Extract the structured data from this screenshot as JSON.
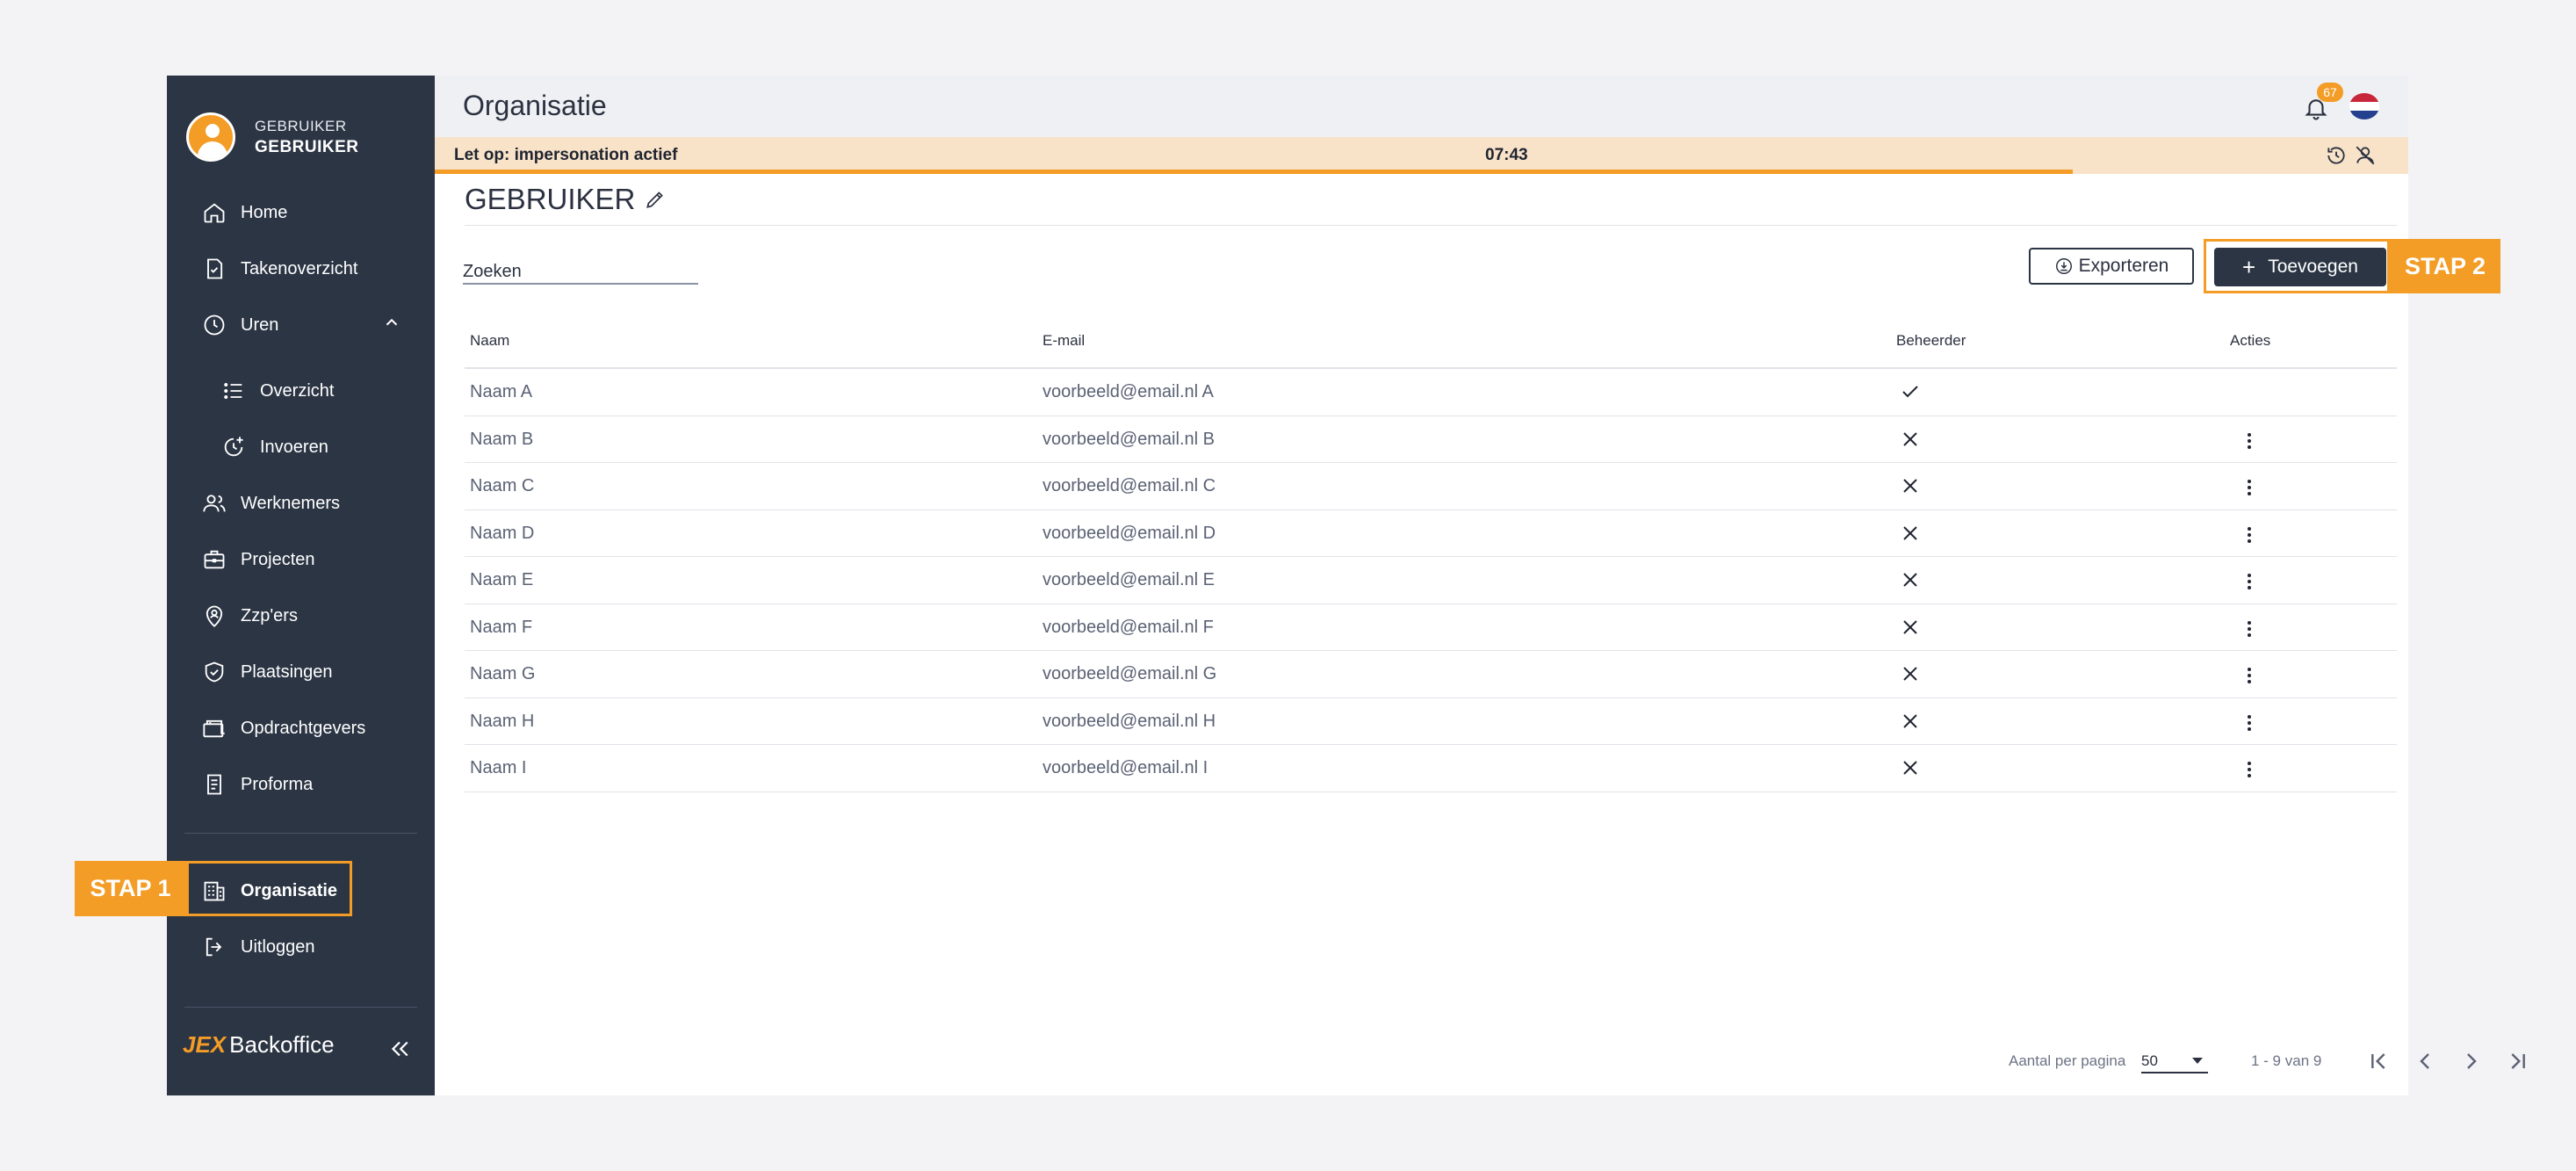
{
  "user": {
    "line1": "GEBRUIKER",
    "line2": "GEBRUIKER"
  },
  "sidebar": {
    "items": [
      {
        "label": "Home",
        "icon": "home-icon"
      },
      {
        "label": "Takenoverzicht",
        "icon": "task-icon"
      },
      {
        "label": "Uren",
        "icon": "clock-icon",
        "expanded": true
      },
      {
        "label": "Overzicht",
        "icon": "list-icon"
      },
      {
        "label": "Invoeren",
        "icon": "clock-add-icon"
      },
      {
        "label": "Werknemers",
        "icon": "users-icon"
      },
      {
        "label": "Projecten",
        "icon": "briefcase-icon"
      },
      {
        "label": "Zzp'ers",
        "icon": "location-user-icon"
      },
      {
        "label": "Plaatsingen",
        "icon": "shield-check-icon"
      },
      {
        "label": "Opdrachtgevers",
        "icon": "folder-briefcase-icon"
      },
      {
        "label": "Proforma",
        "icon": "receipt-icon"
      },
      {
        "label": "Organisatie",
        "icon": "building-icon",
        "active": true
      },
      {
        "label": "Uitloggen",
        "icon": "logout-icon"
      }
    ],
    "brand_jex": "JEX",
    "brand_name": "Backoffice"
  },
  "header": {
    "title": "Organisatie",
    "notifications": "67"
  },
  "banner": {
    "text": "Let op: impersonation actief",
    "time": "07:43",
    "progress": 0.83
  },
  "content": {
    "entity_title": "GEBRUIKER",
    "search_placeholder": "Zoeken",
    "export_label": "Exporteren",
    "add_label": "Toevoegen"
  },
  "callouts": {
    "step1": "STAP 1",
    "step2": "STAP 2"
  },
  "table": {
    "headers": {
      "name": "Naam",
      "email": "E-mail",
      "admin": "Beheerder",
      "actions": "Acties"
    },
    "rows": [
      {
        "name": "Naam A",
        "email": "voorbeeld@email.nl A",
        "admin": true
      },
      {
        "name": "Naam B",
        "email": "voorbeeld@email.nl B",
        "admin": false
      },
      {
        "name": "Naam C",
        "email": "voorbeeld@email.nl C",
        "admin": false
      },
      {
        "name": "Naam D",
        "email": "voorbeeld@email.nl D",
        "admin": false
      },
      {
        "name": "Naam E",
        "email": "voorbeeld@email.nl E",
        "admin": false
      },
      {
        "name": "Naam F",
        "email": "voorbeeld@email.nl F",
        "admin": false
      },
      {
        "name": "Naam G",
        "email": "voorbeeld@email.nl G",
        "admin": false
      },
      {
        "name": "Naam H",
        "email": "voorbeeld@email.nl H",
        "admin": false
      },
      {
        "name": "Naam I",
        "email": "voorbeeld@email.nl I",
        "admin": false
      }
    ]
  },
  "pagination": {
    "per_page_label": "Aantal per pagina",
    "per_page_value": "50",
    "range": "1 - 9 van 9"
  },
  "colors": {
    "accent": "#f39c26",
    "sidebar": "#2c3544",
    "banner": "#f8e3c8"
  }
}
